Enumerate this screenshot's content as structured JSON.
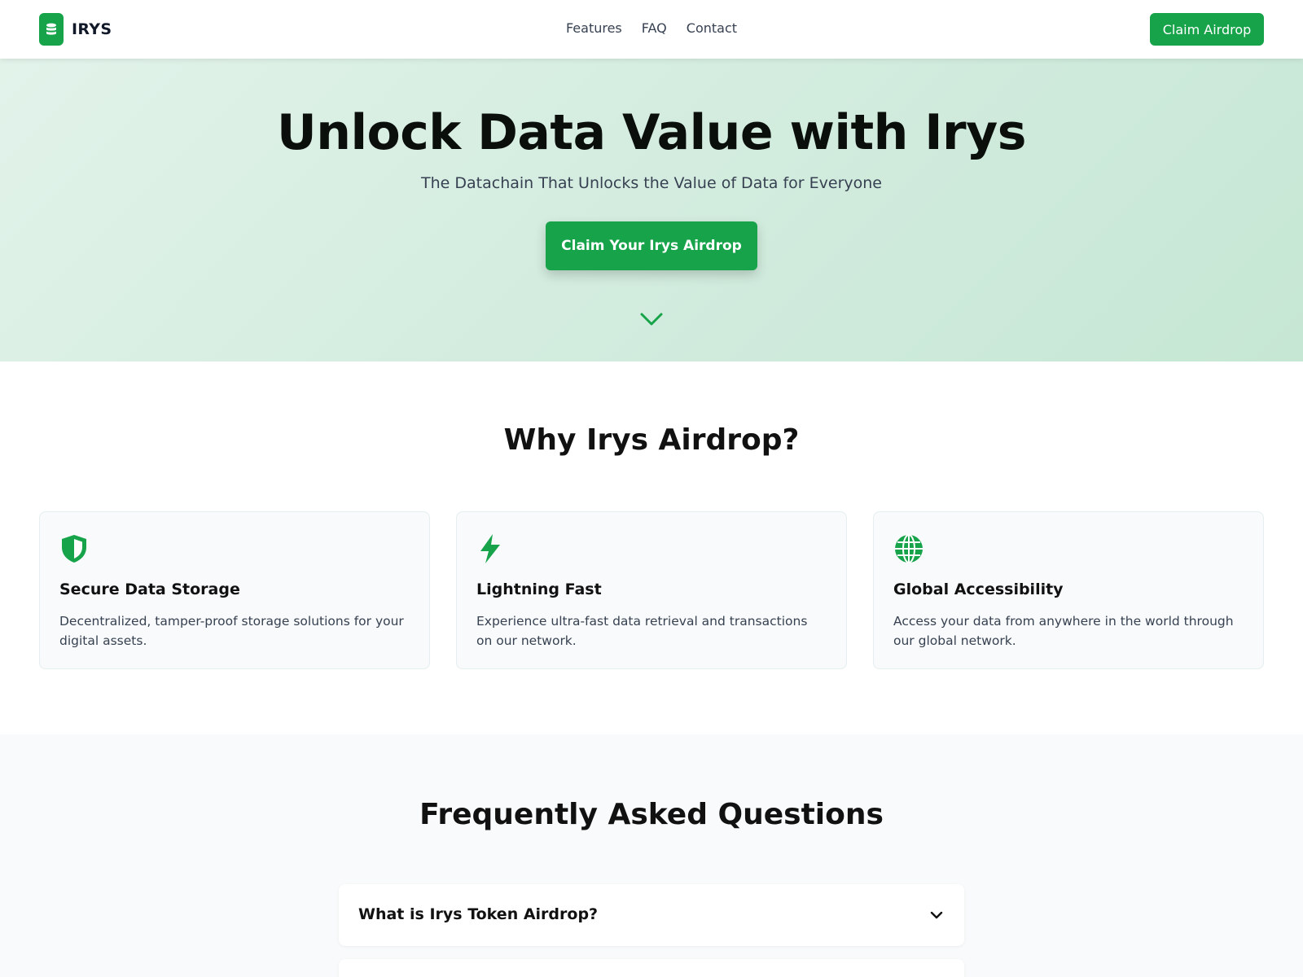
{
  "header": {
    "brand": "IRYS",
    "nav": [
      "Features",
      "FAQ",
      "Contact"
    ],
    "cta_label": "Claim Airdrop"
  },
  "hero": {
    "title": "Unlock Data Value with Irys",
    "subtitle": "The Datachain That Unlocks the Value of Data for Everyone",
    "cta_label": "Claim Your Irys Airdrop"
  },
  "features": {
    "title": "Why Irys Airdrop?",
    "items": [
      {
        "icon": "shield-icon",
        "title": "Secure Data Storage",
        "desc": "Decentralized, tamper-proof storage solutions for your digital assets."
      },
      {
        "icon": "lightning-icon",
        "title": "Lightning Fast",
        "desc": "Experience ultra-fast data retrieval and transactions on our network."
      },
      {
        "icon": "globe-icon",
        "title": "Global Accessibility",
        "desc": "Access your data from anywhere in the world through our global network."
      }
    ]
  },
  "faq": {
    "title": "Frequently Asked Questions",
    "items": [
      {
        "question": "What is Irys Token Airdrop?"
      },
      {
        "question": ""
      }
    ]
  },
  "colors": {
    "accent": "#16a34a",
    "hero_bg_start": "#e2f3ea",
    "hero_bg_end": "#c6e7d4",
    "card_bg": "#f8fafb"
  }
}
